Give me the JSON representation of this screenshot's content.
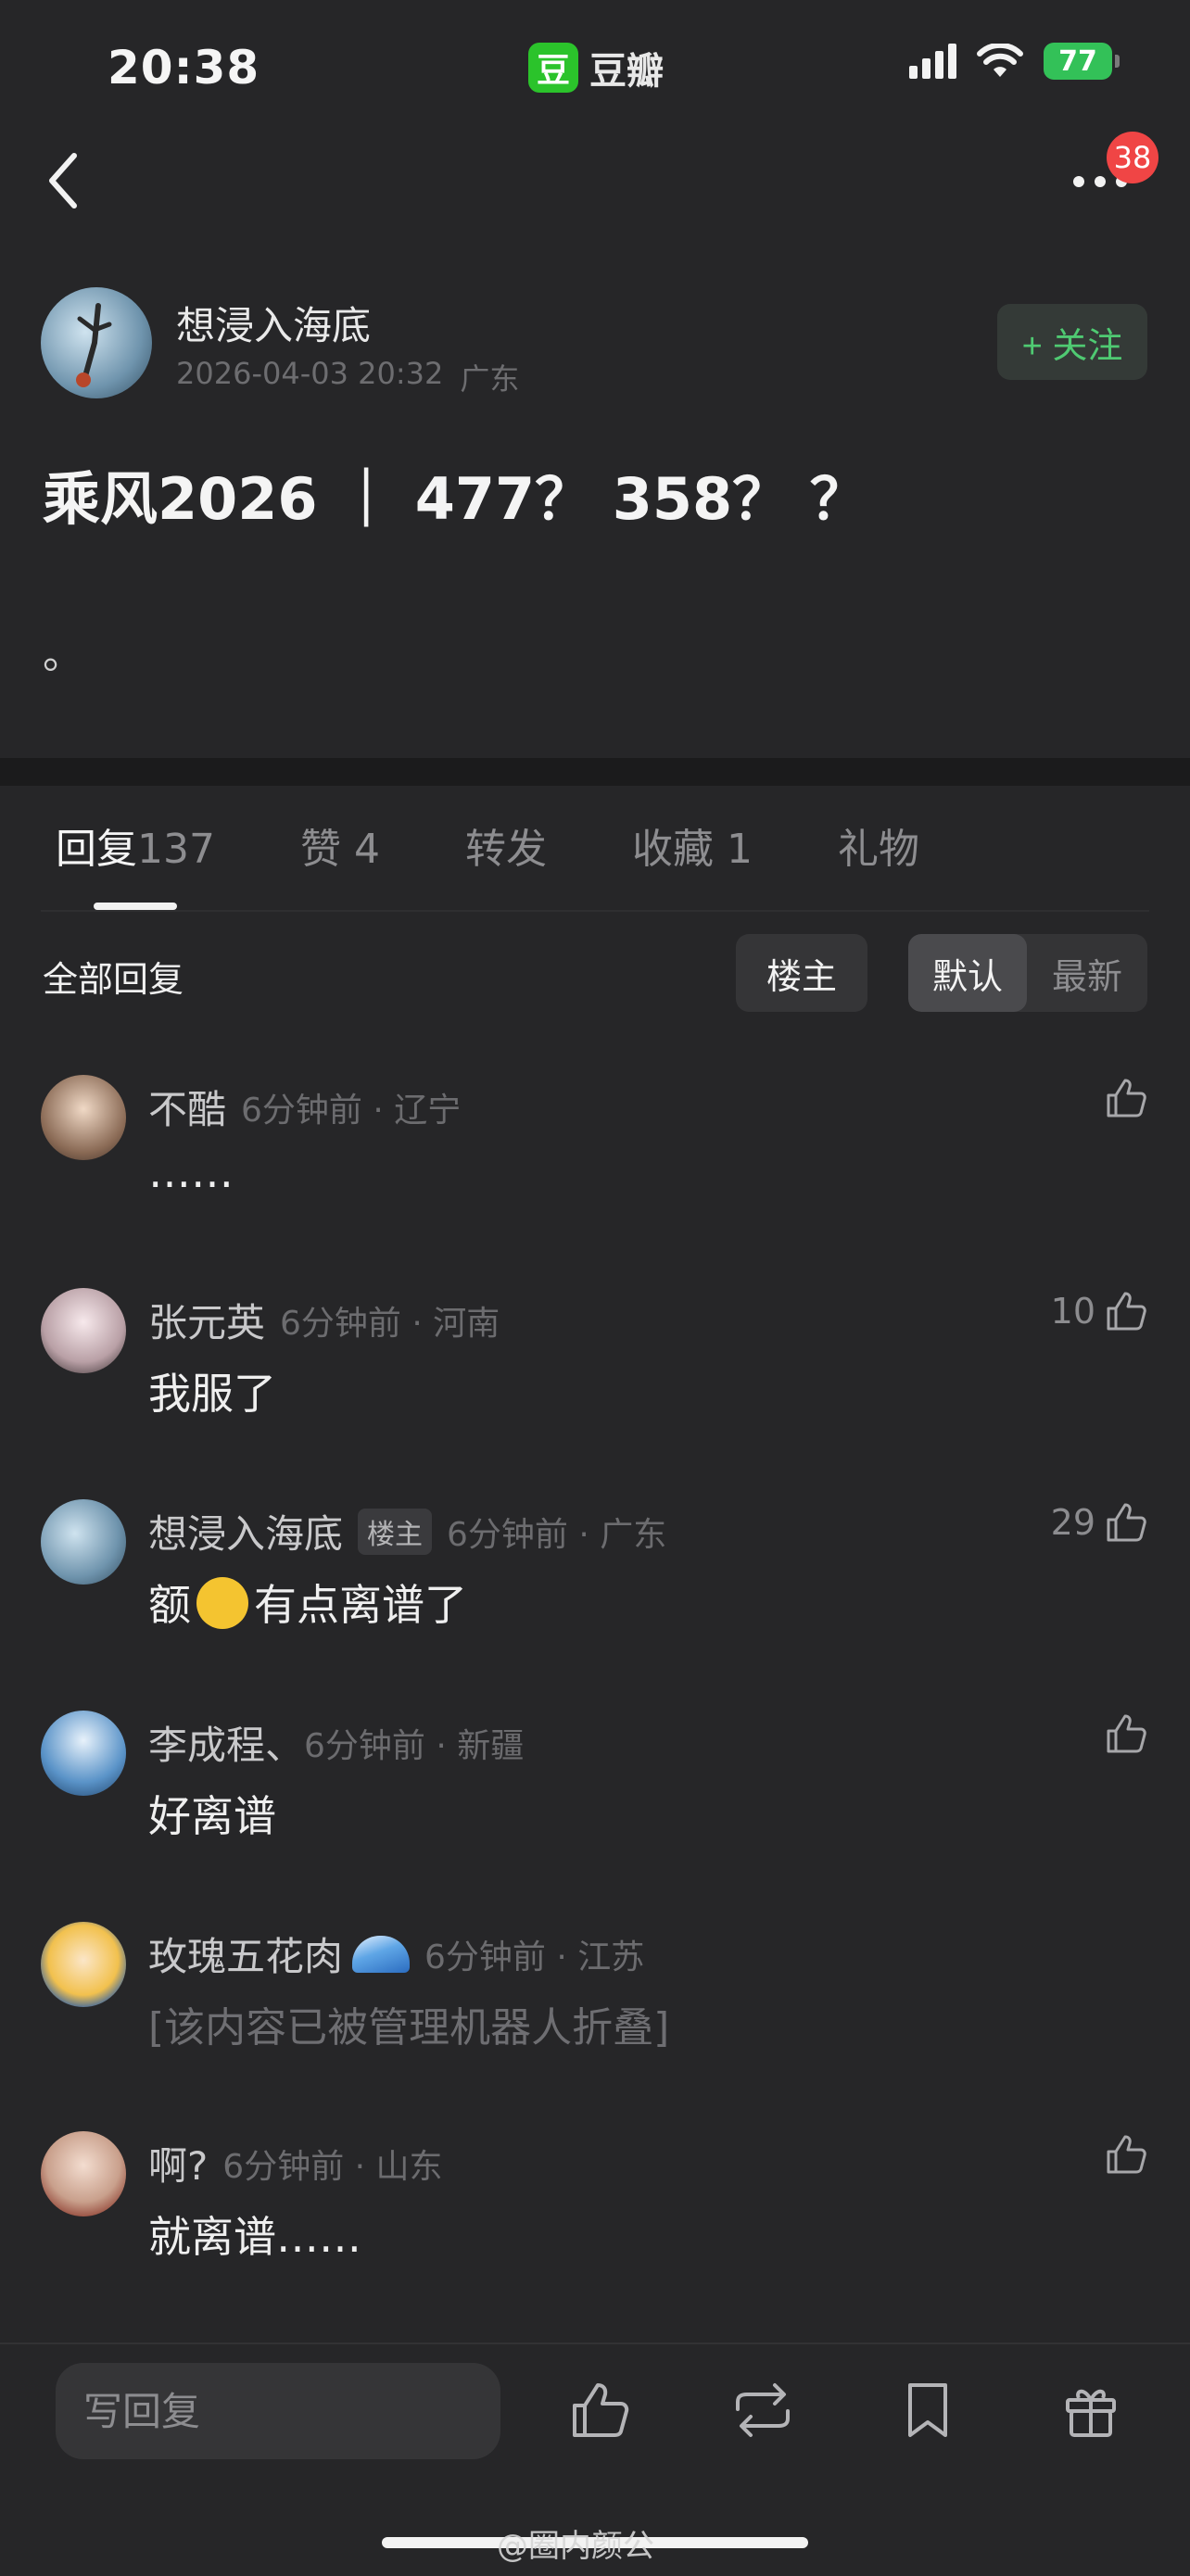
{
  "status_bar": {
    "time": "20:38",
    "app_icon_char": "豆",
    "app_name": "豆瓣",
    "battery": "77"
  },
  "nav": {
    "notification_count": "38"
  },
  "post": {
    "author": "想浸入海底",
    "date": "2026-04-03 20:32",
    "location": "广东",
    "follow_label": "+ 关注",
    "title": "乘风2026 ｜ 477？ 358？ ？",
    "body": "。"
  },
  "tabs": [
    {
      "label": "回复",
      "count": "137"
    },
    {
      "label": "赞",
      "count": "4"
    },
    {
      "label": "转发",
      "count": ""
    },
    {
      "label": "收藏",
      "count": "1"
    },
    {
      "label": "礼物",
      "count": ""
    }
  ],
  "filters": {
    "all_replies": "全部回复",
    "op_only": "楼主",
    "sort_default": "默认",
    "sort_newest": "最新"
  },
  "comments": [
    {
      "name": "不酷",
      "meta": "6分钟前 · 辽宁",
      "text": "……",
      "likes": "",
      "is_op": false,
      "op_label": "",
      "folded": false
    },
    {
      "name": "张元英",
      "meta": "6分钟前 · 河南",
      "text": "我服了",
      "likes": "10",
      "is_op": false,
      "op_label": "",
      "folded": false
    },
    {
      "name": "想浸入海底",
      "meta": "6分钟前 · 广东",
      "text_before": "额",
      "text_after": "有点离谱了",
      "likes": "29",
      "is_op": true,
      "op_label": "楼主",
      "folded": false
    },
    {
      "name": "李成程、",
      "meta": "6分钟前 · 新疆",
      "text": "好离谱",
      "likes": "",
      "is_op": false,
      "op_label": "",
      "folded": false
    },
    {
      "name": "玫瑰五花肉",
      "meta": "6分钟前 · 江苏",
      "text": "[该内容已被管理机器人折叠]",
      "likes": "",
      "is_op": false,
      "op_label": "",
      "folded": true
    },
    {
      "name": "啊?",
      "meta": "6分钟前 · 山东",
      "text": "就离谱……",
      "likes": "",
      "is_op": false,
      "op_label": "",
      "folded": false
    }
  ],
  "bottom_bar": {
    "reply_placeholder": "写回复"
  },
  "watermark": "@圈内颜公",
  "colors": {
    "background": "#262628",
    "accent_green": "#4fca72",
    "badge_red": "#f04545"
  }
}
